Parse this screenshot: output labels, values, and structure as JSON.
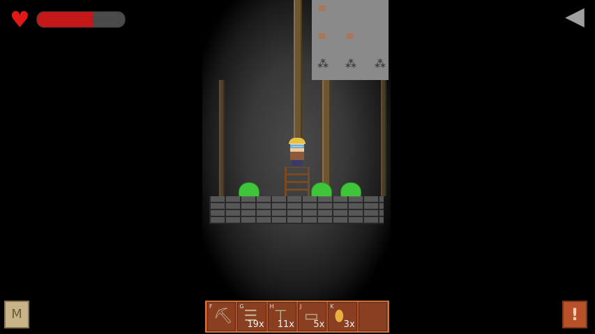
{
  "hud": {
    "health_fraction": 0.64,
    "heart_icon": "♥",
    "back_icon": "◀"
  },
  "corner": {
    "map_label": "M",
    "alert_label": "!"
  },
  "toolbar": {
    "slots": [
      {
        "key": "F",
        "icon": "pickaxe",
        "count": ""
      },
      {
        "key": "G",
        "icon": "ladder",
        "count": "19x"
      },
      {
        "key": "H",
        "icon": "support-beam",
        "count": "11x"
      },
      {
        "key": "J",
        "icon": "platform",
        "count": "5x"
      },
      {
        "key": "K",
        "icon": "torch",
        "count": "3x"
      },
      {
        "key": "",
        "icon": "empty",
        "count": ""
      }
    ]
  }
}
